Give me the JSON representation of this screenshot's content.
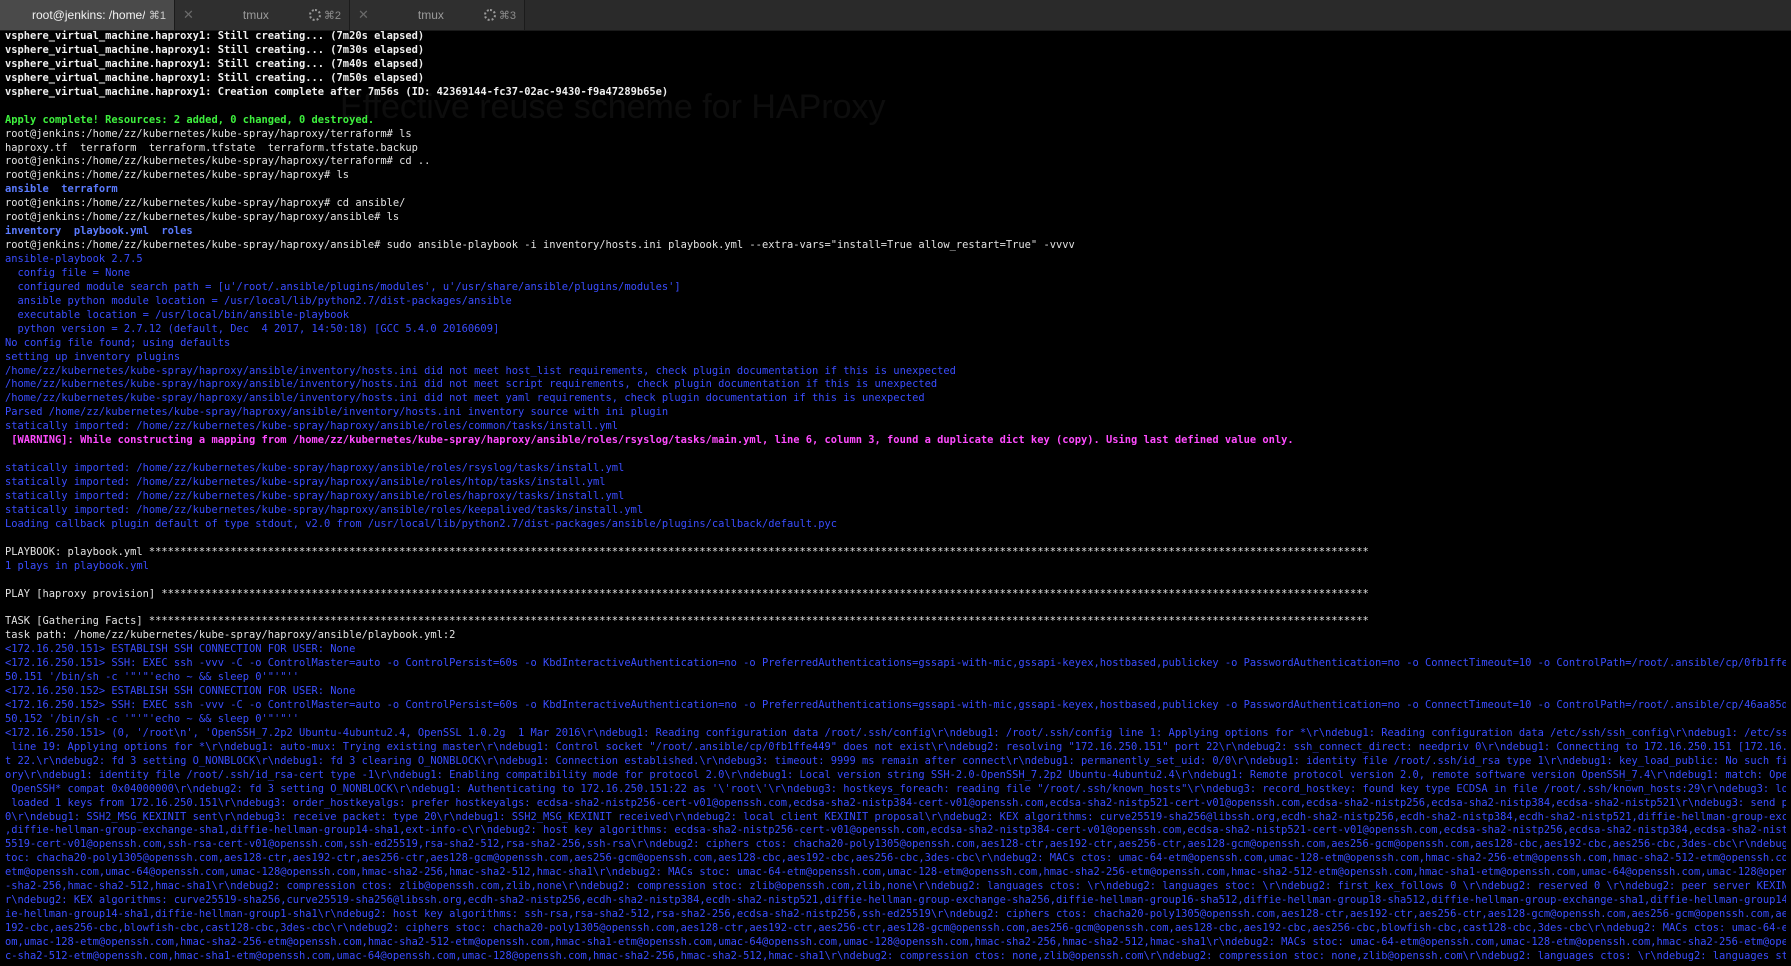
{
  "tabs": [
    {
      "close": "",
      "title": "root@jenkins: /home/...",
      "shortcut": "⌘1",
      "spinner": false,
      "active": true
    },
    {
      "close": "✕",
      "title": "tmux",
      "shortcut": "⌘2",
      "spinner": true,
      "active": false
    },
    {
      "close": "✕",
      "title": "tmux",
      "shortcut": "⌘3",
      "spinner": true,
      "active": false
    }
  ],
  "ghost_title": "Effective reuse scheme for HAProxy",
  "lines": [
    {
      "c": "w",
      "t": "vsphere_virtual_machine.haproxy1: Still creating... (7m20s elapsed)"
    },
    {
      "c": "w",
      "t": "vsphere_virtual_machine.haproxy1: Still creating... (7m30s elapsed)"
    },
    {
      "c": "w",
      "t": "vsphere_virtual_machine.haproxy1: Still creating... (7m40s elapsed)"
    },
    {
      "c": "w",
      "t": "vsphere_virtual_machine.haproxy1: Still creating... (7m50s elapsed)"
    },
    {
      "c": "w",
      "t": "vsphere_virtual_machine.haproxy1: Creation complete after 7m56s (ID: 42369144-fc37-02ac-9430-f9a47289b65e)"
    },
    {
      "c": "n",
      "t": ""
    },
    {
      "c": "g",
      "t": "Apply complete! Resources: 2 added, 0 changed, 0 destroyed."
    },
    {
      "c": "n",
      "t": "root@jenkins:/home/zz/kubernetes/kube-spray/haproxy/terraform# ls"
    },
    {
      "c": "n",
      "t": "haproxy.tf  terraform  terraform.tfstate  terraform.tfstate.backup"
    },
    {
      "c": "n",
      "t": "root@jenkins:/home/zz/kubernetes/kube-spray/haproxy/terraform# cd .."
    },
    {
      "c": "n",
      "t": "root@jenkins:/home/zz/kubernetes/kube-spray/haproxy# ls"
    },
    {
      "c": "bb",
      "t": "ansible  terraform"
    },
    {
      "c": "n",
      "t": "root@jenkins:/home/zz/kubernetes/kube-spray/haproxy# cd ansible/"
    },
    {
      "c": "n",
      "t": "root@jenkins:/home/zz/kubernetes/kube-spray/haproxy/ansible# ls"
    },
    {
      "c": "bb",
      "t": "inventory  playbook.yml  roles"
    },
    {
      "c": "n",
      "t": "root@jenkins:/home/zz/kubernetes/kube-spray/haproxy/ansible# sudo ansible-playbook -i inventory/hosts.ini playbook.yml --extra-vars=\"install=True allow_restart=True\" -vvvv"
    },
    {
      "c": "b",
      "t": "ansible-playbook 2.7.5"
    },
    {
      "c": "b",
      "t": "  config file = None"
    },
    {
      "c": "b",
      "t": "  configured module search path = [u'/root/.ansible/plugins/modules', u'/usr/share/ansible/plugins/modules']"
    },
    {
      "c": "b",
      "t": "  ansible python module location = /usr/local/lib/python2.7/dist-packages/ansible"
    },
    {
      "c": "b",
      "t": "  executable location = /usr/local/bin/ansible-playbook"
    },
    {
      "c": "b",
      "t": "  python version = 2.7.12 (default, Dec  4 2017, 14:50:18) [GCC 5.4.0 20160609]"
    },
    {
      "c": "b",
      "t": "No config file found; using defaults"
    },
    {
      "c": "b",
      "t": "setting up inventory plugins"
    },
    {
      "c": "b",
      "t": "/home/zz/kubernetes/kube-spray/haproxy/ansible/inventory/hosts.ini did not meet host_list requirements, check plugin documentation if this is unexpected"
    },
    {
      "c": "b",
      "t": "/home/zz/kubernetes/kube-spray/haproxy/ansible/inventory/hosts.ini did not meet script requirements, check plugin documentation if this is unexpected"
    },
    {
      "c": "b",
      "t": "/home/zz/kubernetes/kube-spray/haproxy/ansible/inventory/hosts.ini did not meet yaml requirements, check plugin documentation if this is unexpected"
    },
    {
      "c": "b",
      "t": "Parsed /home/zz/kubernetes/kube-spray/haproxy/ansible/inventory/hosts.ini inventory source with ini plugin"
    },
    {
      "c": "b",
      "t": "statically imported: /home/zz/kubernetes/kube-spray/haproxy/ansible/roles/common/tasks/install.yml"
    },
    {
      "c": "m",
      "t": " [WARNING]: While constructing a mapping from /home/zz/kubernetes/kube-spray/haproxy/ansible/roles/rsyslog/tasks/main.yml, line 6, column 3, found a duplicate dict key (copy). Using last defined value only."
    },
    {
      "c": "n",
      "t": ""
    },
    {
      "c": "b",
      "t": "statically imported: /home/zz/kubernetes/kube-spray/haproxy/ansible/roles/rsyslog/tasks/install.yml"
    },
    {
      "c": "b",
      "t": "statically imported: /home/zz/kubernetes/kube-spray/haproxy/ansible/roles/htop/tasks/install.yml"
    },
    {
      "c": "b",
      "t": "statically imported: /home/zz/kubernetes/kube-spray/haproxy/ansible/roles/haproxy/tasks/install.yml"
    },
    {
      "c": "b",
      "t": "statically imported: /home/zz/kubernetes/kube-spray/haproxy/ansible/roles/keepalived/tasks/install.yml"
    },
    {
      "c": "b",
      "t": "Loading callback plugin default of type stdout, v2.0 from /usr/local/lib/python2.7/dist-packages/ansible/plugins/callback/default.pyc"
    },
    {
      "c": "n",
      "t": ""
    },
    {
      "c": "n",
      "t": "PLAYBOOK: playbook.yml ***************************************************************************************************************************************************************************************************"
    },
    {
      "c": "b",
      "t": "1 plays in playbook.yml"
    },
    {
      "c": "n",
      "t": ""
    },
    {
      "c": "n",
      "t": "PLAY [haproxy provision] *************************************************************************************************************************************************************************************************"
    },
    {
      "c": "n",
      "t": ""
    },
    {
      "c": "n",
      "t": "TASK [Gathering Facts] ***************************************************************************************************************************************************************************************************"
    },
    {
      "c": "n",
      "t": "task path: /home/zz/kubernetes/kube-spray/haproxy/ansible/playbook.yml:2"
    },
    {
      "c": "b",
      "t": "<172.16.250.151> ESTABLISH SSH CONNECTION FOR USER: None"
    },
    {
      "c": "b",
      "t": "<172.16.250.151> SSH: EXEC ssh -vvv -C -o ControlMaster=auto -o ControlPersist=60s -o KbdInteractiveAuthentication=no -o PreferredAuthentications=gssapi-with-mic,gssapi-keyex,hostbased,publickey -o PasswordAuthentication=no -o ConnectTimeout=10 -o ControlPath=/root/.ansible/cp/0fb1ffe449 172.16.2"
    },
    {
      "c": "b",
      "t": "50.151 '/bin/sh -c '\"'\"'echo ~ && sleep 0'\"'\"''"
    },
    {
      "c": "b",
      "t": "<172.16.250.152> ESTABLISH SSH CONNECTION FOR USER: None"
    },
    {
      "c": "b",
      "t": "<172.16.250.152> SSH: EXEC ssh -vvv -C -o ControlMaster=auto -o ControlPersist=60s -o KbdInteractiveAuthentication=no -o PreferredAuthentications=gssapi-with-mic,gssapi-keyex,hostbased,publickey -o PasswordAuthentication=no -o ConnectTimeout=10 -o ControlPath=/root/.ansible/cp/46aa85da3c 172.16.2"
    },
    {
      "c": "b",
      "t": "50.152 '/bin/sh -c '\"'\"'echo ~ && sleep 0'\"'\"''"
    },
    {
      "c": "b",
      "t": "<172.16.250.151> (0, '/root\\n', 'OpenSSH_7.2p2 Ubuntu-4ubuntu2.4, OpenSSL 1.0.2g  1 Mar 2016\\r\\ndebug1: Reading configuration data /root/.ssh/config\\r\\ndebug1: /root/.ssh/config line 1: Applying options for *\\r\\ndebug1: Reading configuration data /etc/ssh/ssh_config\\r\\ndebug1: /etc/ssh/ssh_config"
    },
    {
      "c": "b",
      "t": " line 19: Applying options for *\\r\\ndebug1: auto-mux: Trying existing master\\r\\ndebug1: Control socket \"/root/.ansible/cp/0fb1ffe449\" does not exist\\r\\ndebug2: resolving \"172.16.250.151\" port 22\\r\\ndebug2: ssh_connect_direct: needpriv 0\\r\\ndebug1: Connecting to 172.16.250.151 [172.16.250.151] por"
    },
    {
      "c": "b",
      "t": "t 22.\\r\\ndebug2: fd 3 setting O_NONBLOCK\\r\\ndebug1: fd 3 clearing O_NONBLOCK\\r\\ndebug1: Connection established.\\r\\ndebug3: timeout: 9999 ms remain after connect\\r\\ndebug1: permanently_set_uid: 0/0\\r\\ndebug1: identity file /root/.ssh/id_rsa type 1\\r\\ndebug1: key_load_public: No such file or direct"
    },
    {
      "c": "b",
      "t": "ory\\r\\ndebug1: identity file /root/.ssh/id_rsa-cert type -1\\r\\ndebug1: Enabling compatibility mode for protocol 2.0\\r\\ndebug1: Local version string SSH-2.0-OpenSSH_7.2p2 Ubuntu-4ubuntu2.4\\r\\ndebug1: Remote protocol version 2.0, remote software version OpenSSH_7.4\\r\\ndebug1: match: OpenSSH_7.4 pat"
    },
    {
      "c": "b",
      "t": " OpenSSH* compat 0x04000000\\r\\ndebug2: fd 3 setting O_NONBLOCK\\r\\ndebug1: Authenticating to 172.16.250.151:22 as '\\'root\\'\\r\\ndebug3: hostkeys_foreach: reading file \"/root/.ssh/known_hosts\"\\r\\ndebug3: record_hostkey: found key type ECDSA in file /root/.ssh/known_hosts:29\\r\\ndebug3: load_hostkeys:"
    },
    {
      "c": "b",
      "t": " loaded 1 keys from 172.16.250.151\\r\\ndebug3: order_hostkeyalgs: prefer hostkeyalgs: ecdsa-sha2-nistp256-cert-v01@openssh.com,ecdsa-sha2-nistp384-cert-v01@openssh.com,ecdsa-sha2-nistp521-cert-v01@openssh.com,ecdsa-sha2-nistp256,ecdsa-sha2-nistp384,ecdsa-sha2-nistp521\\r\\ndebug3: send packet: type 2"
    },
    {
      "c": "b",
      "t": "0\\r\\ndebug1: SSH2_MSG_KEXINIT sent\\r\\ndebug3: receive packet: type 20\\r\\ndebug1: SSH2_MSG_KEXINIT received\\r\\ndebug2: local client KEXINIT proposal\\r\\ndebug2: KEX algorithms: curve25519-sha256@libssh.org,ecdh-sha2-nistp256,ecdh-sha2-nistp384,ecdh-sha2-nistp521,diffie-hellman-group-exchange-sha256"
    },
    {
      "c": "b",
      "t": ",diffie-hellman-group-exchange-sha1,diffie-hellman-group14-sha1,ext-info-c\\r\\ndebug2: host key algorithms: ecdsa-sha2-nistp256-cert-v01@openssh.com,ecdsa-sha2-nistp384-cert-v01@openssh.com,ecdsa-sha2-nistp521-cert-v01@openssh.com,ecdsa-sha2-nistp256,ecdsa-sha2-nistp384,ecdsa-sha2-nistp521,ssh-ed2"
    },
    {
      "c": "b",
      "t": "5519-cert-v01@openssh.com,ssh-rsa-cert-v01@openssh.com,ssh-ed25519,rsa-sha2-512,rsa-sha2-256,ssh-rsa\\r\\ndebug2: ciphers ctos: chacha20-poly1305@openssh.com,aes128-ctr,aes192-ctr,aes256-ctr,aes128-gcm@openssh.com,aes256-gcm@openssh.com,aes128-cbc,aes192-cbc,aes256-cbc,3des-cbc\\r\\ndebug2: ciphers s"
    },
    {
      "c": "b",
      "t": "toc: chacha20-poly1305@openssh.com,aes128-ctr,aes192-ctr,aes256-ctr,aes128-gcm@openssh.com,aes256-gcm@openssh.com,aes128-cbc,aes192-cbc,aes256-cbc,3des-cbc\\r\\ndebug2: MACs ctos: umac-64-etm@openssh.com,umac-128-etm@openssh.com,hmac-sha2-256-etm@openssh.com,hmac-sha2-512-etm@openssh.com,hmac-sha1-"
    },
    {
      "c": "b",
      "t": "etm@openssh.com,umac-64@openssh.com,umac-128@openssh.com,hmac-sha2-256,hmac-sha2-512,hmac-sha1\\r\\ndebug2: MACs stoc: umac-64-etm@openssh.com,umac-128-etm@openssh.com,hmac-sha2-256-etm@openssh.com,hmac-sha2-512-etm@openssh.com,hmac-sha1-etm@openssh.com,umac-64@openssh.com,umac-128@openssh.com,hmac"
    },
    {
      "c": "b",
      "t": "-sha2-256,hmac-sha2-512,hmac-sha1\\r\\ndebug2: compression ctos: zlib@openssh.com,zlib,none\\r\\ndebug2: compression stoc: zlib@openssh.com,zlib,none\\r\\ndebug2: languages ctos: \\r\\ndebug2: languages stoc: \\r\\ndebug2: first_kex_follows 0 \\r\\ndebug2: reserved 0 \\r\\ndebug2: peer server KEXINIT proposal\\"
    },
    {
      "c": "b",
      "t": "r\\ndebug2: KEX algorithms: curve25519-sha256,curve25519-sha256@libssh.org,ecdh-sha2-nistp256,ecdh-sha2-nistp384,ecdh-sha2-nistp521,diffie-hellman-group-exchange-sha256,diffie-hellman-group16-sha512,diffie-hellman-group18-sha512,diffie-hellman-group-exchange-sha1,diffie-hellman-group14-sha256,diff"
    },
    {
      "c": "b",
      "t": "ie-hellman-group14-sha1,diffie-hellman-group1-sha1\\r\\ndebug2: host key algorithms: ssh-rsa,rsa-sha2-512,rsa-sha2-256,ecdsa-sha2-nistp256,ssh-ed25519\\r\\ndebug2: ciphers ctos: chacha20-poly1305@openssh.com,aes128-ctr,aes192-ctr,aes256-ctr,aes128-gcm@openssh.com,aes256-gcm@openssh.com,aes128-cbc,aes"
    },
    {
      "c": "b",
      "t": "192-cbc,aes256-cbc,blowfish-cbc,cast128-cbc,3des-cbc\\r\\ndebug2: ciphers stoc: chacha20-poly1305@openssh.com,aes128-ctr,aes192-ctr,aes256-ctr,aes128-gcm@openssh.com,aes256-gcm@openssh.com,aes128-cbc,aes192-cbc,aes256-cbc,blowfish-cbc,cast128-cbc,3des-cbc\\r\\ndebug2: MACs ctos: umac-64-etm@openssh.c"
    },
    {
      "c": "b",
      "t": "om,umac-128-etm@openssh.com,hmac-sha2-256-etm@openssh.com,hmac-sha2-512-etm@openssh.com,hmac-sha1-etm@openssh.com,umac-64@openssh.com,umac-128@openssh.com,hmac-sha2-256,hmac-sha2-512,hmac-sha1\\r\\ndebug2: MACs stoc: umac-64-etm@openssh.com,umac-128-etm@openssh.com,hmac-sha2-256-etm@openssh.com,hma"
    },
    {
      "c": "b",
      "t": "c-sha2-512-etm@openssh.com,hmac-sha1-etm@openssh.com,umac-64@openssh.com,umac-128@openssh.com,hmac-sha2-256,hmac-sha2-512,hmac-sha1\\r\\ndebug2: compression ctos: none,zlib@openssh.com\\r\\ndebug2: compression stoc: none,zlib@openssh.com\\r\\ndebug2: languages ctos: \\r\\ndebug2: languages stoc: \\r\\nde"
    }
  ]
}
